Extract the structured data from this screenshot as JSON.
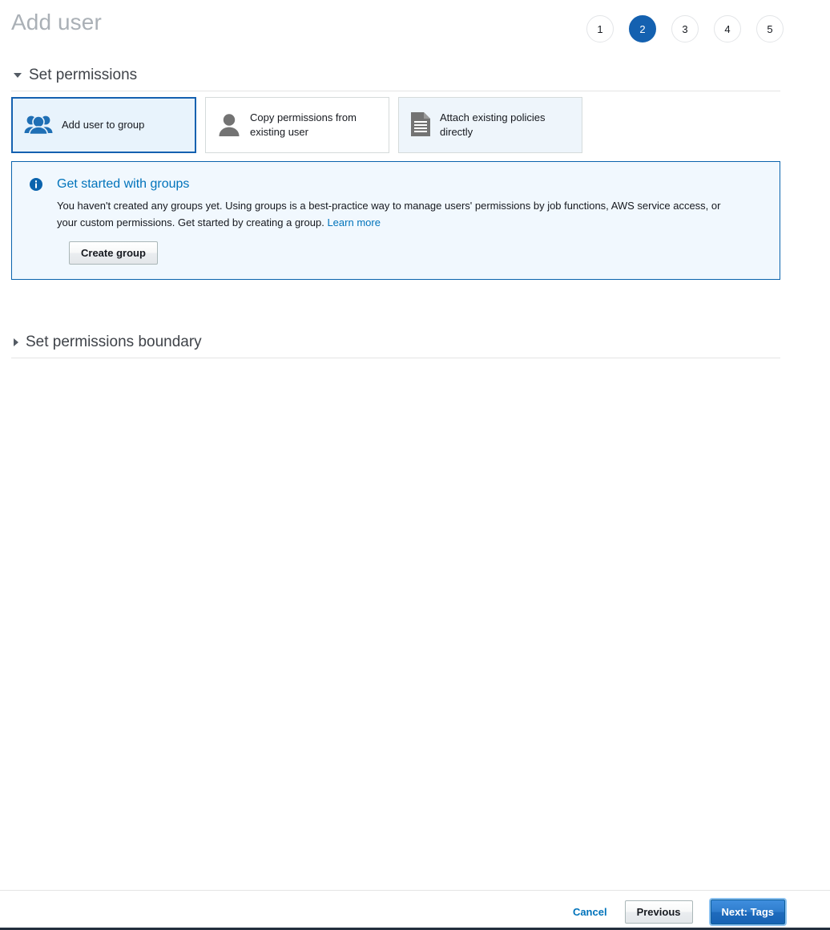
{
  "header": {
    "title": "Add user",
    "steps": [
      {
        "label": "1",
        "active": false
      },
      {
        "label": "2",
        "active": true
      },
      {
        "label": "3",
        "active": false
      },
      {
        "label": "4",
        "active": false
      },
      {
        "label": "5",
        "active": false
      }
    ],
    "active_step": "2"
  },
  "sections": {
    "permissions": {
      "title": "Set permissions",
      "expanded": true
    },
    "permissions_boundary": {
      "title": "Set permissions boundary",
      "expanded": false
    }
  },
  "permission_options": [
    {
      "label": "Add user to group",
      "icon": "group-of-people-icon",
      "state": "selected"
    },
    {
      "label": "Copy permissions from existing user",
      "icon": "person-icon",
      "state": "default"
    },
    {
      "label": "Attach existing policies directly",
      "icon": "document-policy-icon",
      "state": "hovered"
    }
  ],
  "info_box": {
    "icon": "info-circle-icon",
    "title": "Get started with groups",
    "body_text": "You haven't created any groups yet. Using groups is a best-practice way to manage users' permissions by job functions, AWS service access, or your custom permissions. Get started by creating a group.",
    "link_label": "Learn more",
    "button_label": "Create group"
  },
  "footer": {
    "cancel_label": "Cancel",
    "previous_label": "Previous",
    "next_label": "Next: Tags"
  },
  "colors": {
    "accent_blue": "#1461b0",
    "link_blue": "#0073bb",
    "info_bg": "#f1f8fe",
    "info_border": "#0a63ad",
    "selected_card_bg": "#e8f3fc",
    "hover_card_bg": "#eef5fb",
    "title_grey": "#aab0b6",
    "icon_grey": "#737373",
    "bottom_bar": "#232f3e"
  }
}
